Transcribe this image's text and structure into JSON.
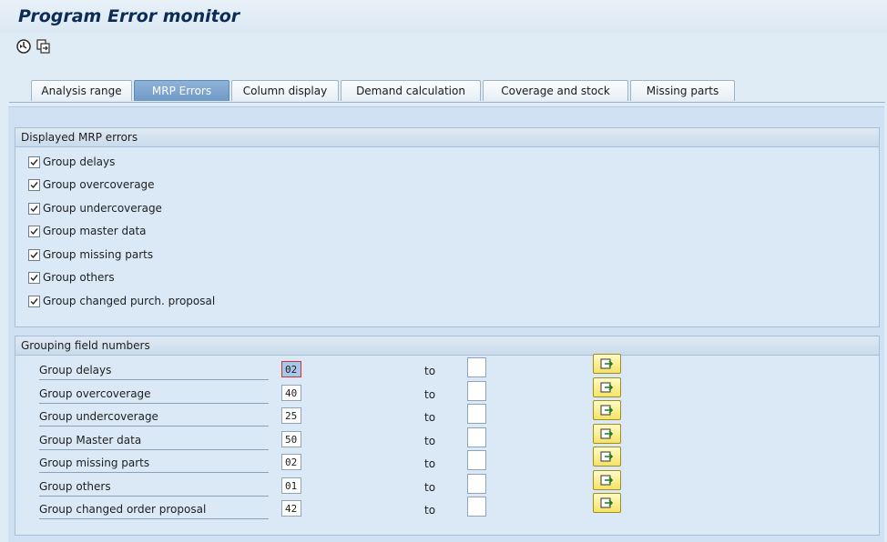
{
  "title": "Program Error monitor",
  "toolbar": {
    "buttons": [
      {
        "icon": "execute-clock-icon"
      },
      {
        "icon": "multiple-selection-icon"
      }
    ]
  },
  "tabs": [
    {
      "label": "Analysis range",
      "active": false
    },
    {
      "label": "MRP Errors",
      "active": true
    },
    {
      "label": "Column display",
      "active": false
    },
    {
      "label": "Demand calculation",
      "active": false
    },
    {
      "label": "Coverage and stock",
      "active": false
    },
    {
      "label": "Missing parts",
      "active": false
    }
  ],
  "displayed_errors": {
    "header": "Displayed MRP errors",
    "items": [
      {
        "label": "Group delays",
        "checked": true
      },
      {
        "label": "Group overcoverage",
        "checked": true
      },
      {
        "label": "Group undercoverage",
        "checked": true
      },
      {
        "label": "Group master data",
        "checked": true
      },
      {
        "label": "Group missing parts",
        "checked": true
      },
      {
        "label": "Group others",
        "checked": true
      },
      {
        "label": "Group changed purch. proposal",
        "checked": true
      }
    ]
  },
  "grouping": {
    "header": "Grouping field numbers",
    "to_label": "to",
    "rows": [
      {
        "label": "Group delays",
        "value": "02",
        "to": ""
      },
      {
        "label": "Group overcoverage",
        "value": "40",
        "to": ""
      },
      {
        "label": "Group undercoverage",
        "value": "25",
        "to": ""
      },
      {
        "label": "Group Master data",
        "value": "50",
        "to": ""
      },
      {
        "label": "Group missing parts",
        "value": "02",
        "to": ""
      },
      {
        "label": "Group others",
        "value": "01",
        "to": ""
      },
      {
        "label": "Group changed order proposal",
        "value": "42",
        "to": ""
      }
    ]
  },
  "colors": {
    "accent_tab": "#6f99c7",
    "title": "#0c2c55",
    "multiple_selection_button": "#f5e365"
  }
}
